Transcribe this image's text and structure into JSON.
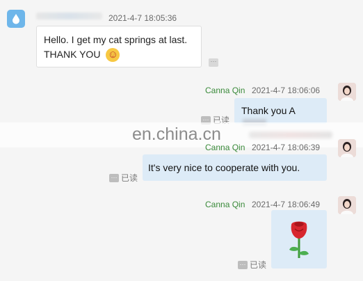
{
  "incoming": {
    "time": "2021-4-7 18:05:36",
    "text_line1": "Hello. I get my cat springs at last.",
    "text_line2": "THANK YOU",
    "emoji": "☺"
  },
  "outgoing": [
    {
      "sender": "Canna Qin",
      "time": "2021-4-7 18:06:06",
      "text": "Thank you A",
      "read_label": "已读"
    },
    {
      "sender": "Canna Qin",
      "time": "2021-4-7 18:06:39",
      "text": "It's very nice to cooperate with you.",
      "read_label": "已读"
    },
    {
      "sender": "Canna Qin",
      "time": "2021-4-7 18:06:49",
      "emoji": "🌹",
      "read_label": "已读"
    }
  ],
  "watermark": "en.china.cn",
  "colors": {
    "sender_name": "#3a8a3a",
    "outgoing_bubble": "#ddebf7",
    "incoming_bubble": "#ffffff",
    "background": "#f5f5f5"
  }
}
